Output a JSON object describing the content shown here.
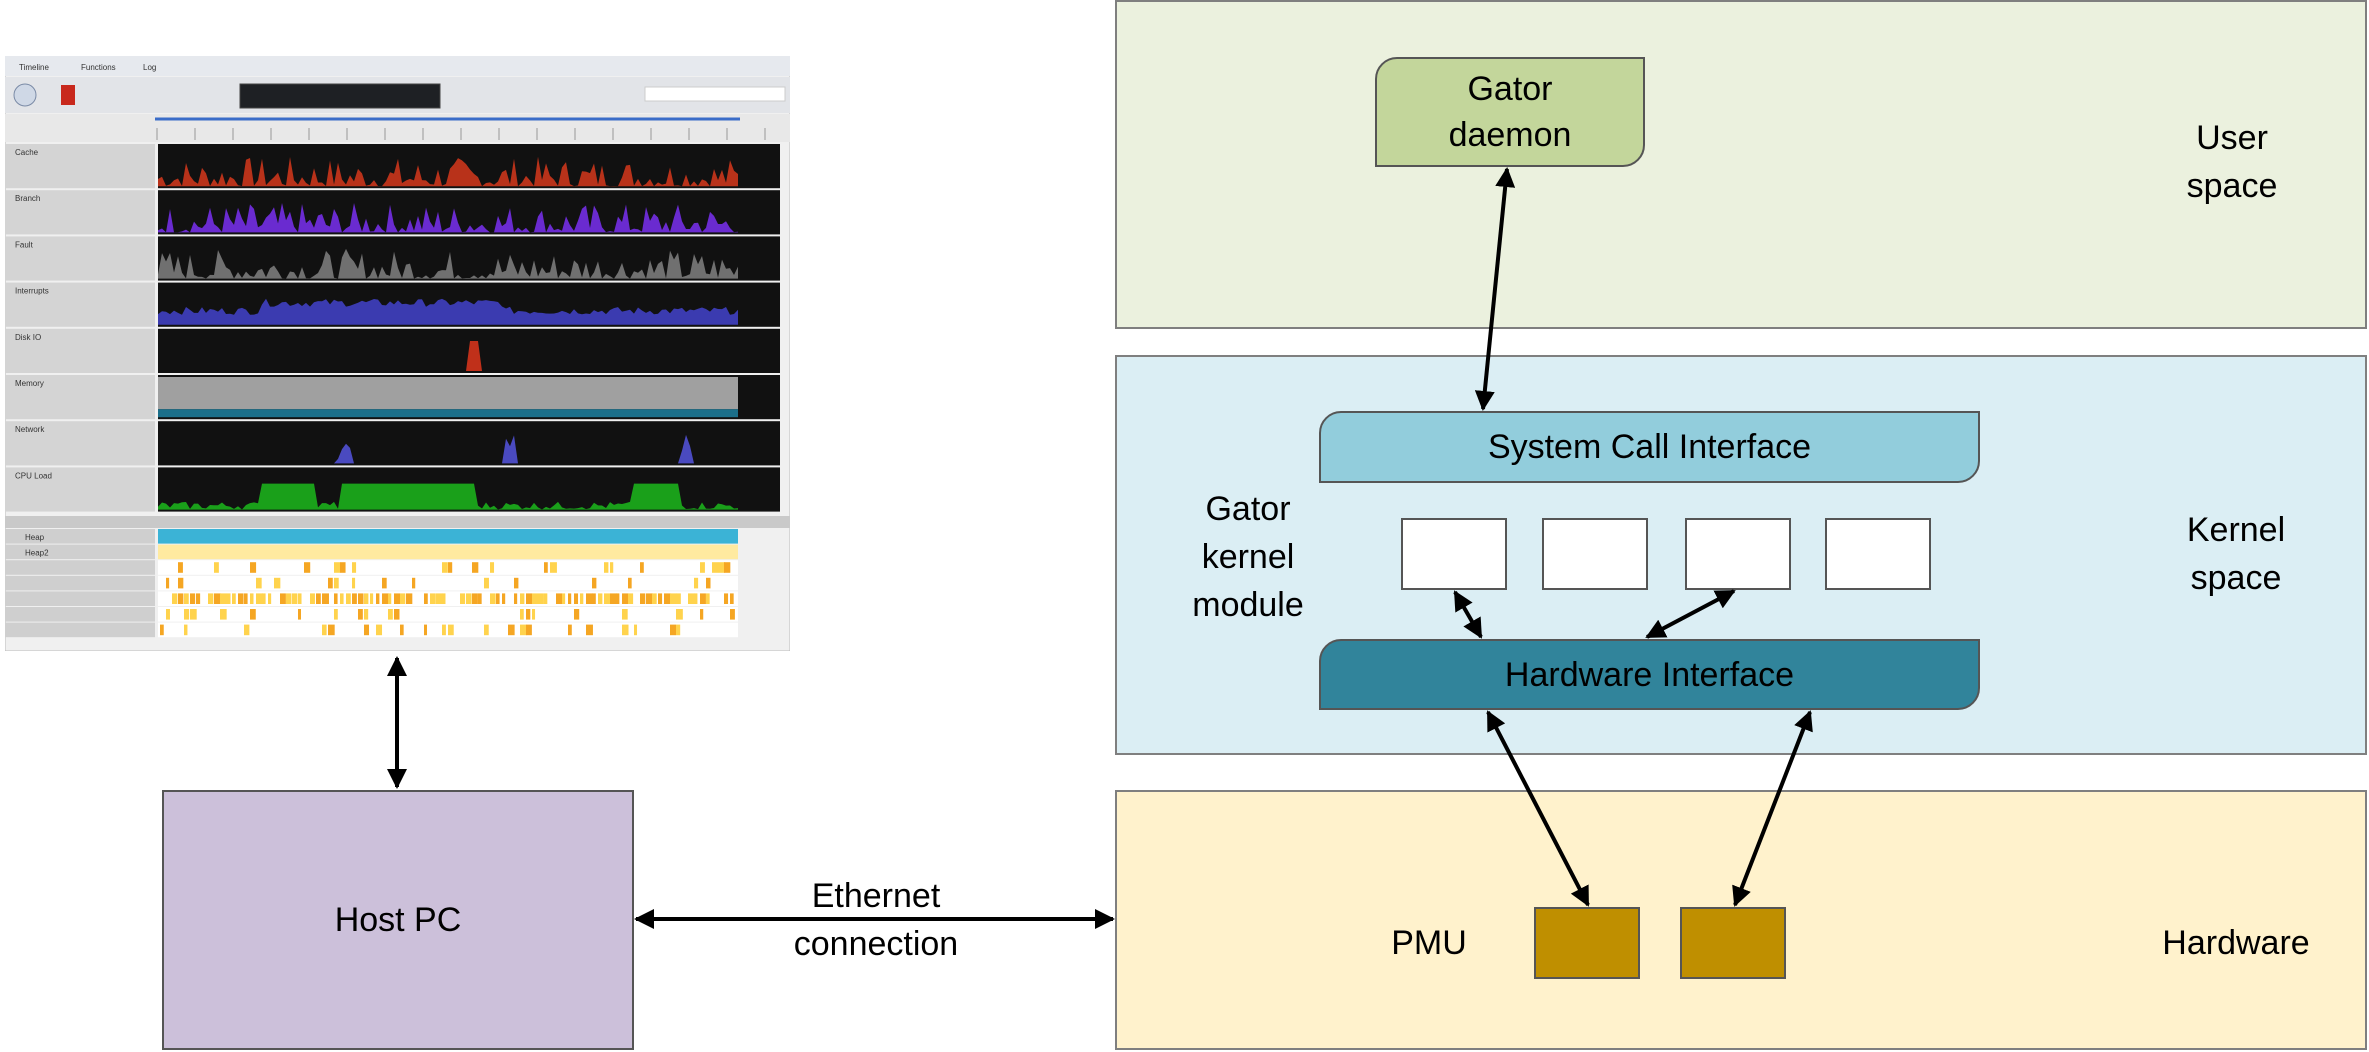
{
  "diagram": {
    "layers": {
      "user_space": {
        "label_line1": "User",
        "label_line2": "space",
        "color": "#ebf1de"
      },
      "kernel_space": {
        "label_line1": "Kernel",
        "label_line2": "space",
        "color": "#dbeef4"
      },
      "hardware": {
        "label": "Hardware",
        "color": "#fff2cc"
      }
    },
    "gator_daemon": {
      "line1": "Gator",
      "line2": "daemon",
      "color": "#c3d69b"
    },
    "gator_kernel_module": {
      "line1": "Gator",
      "line2": "kernel",
      "line3": "module"
    },
    "system_call_interface": {
      "label": "System Call Interface",
      "color": "#92cddc"
    },
    "hardware_interface": {
      "label": "Hardware Interface",
      "color": "#31849b"
    },
    "pmu": {
      "label": "PMU",
      "color": "#bf8f00"
    },
    "host_pc": {
      "label": "Host PC",
      "color": "#ccc0da"
    },
    "ethernet": {
      "line1": "Ethernet",
      "line2": "connection"
    }
  },
  "streamline_screenshot": {
    "tabs": [
      "Timeline",
      "Functions",
      "Log"
    ],
    "tracks": [
      "Cache",
      "Branch",
      "Fault",
      "Interrupts",
      "Disk IO",
      "Memory",
      "Network",
      "CPU Load"
    ],
    "track_colors": [
      "#b8321a",
      "#6a2bd0",
      "#707070",
      "#3b3bb0",
      "#c0301a",
      "#a0a0a0",
      "#4a4ac0",
      "#1aa01a"
    ],
    "process_rows": [
      "Heap",
      "Heap2"
    ]
  }
}
